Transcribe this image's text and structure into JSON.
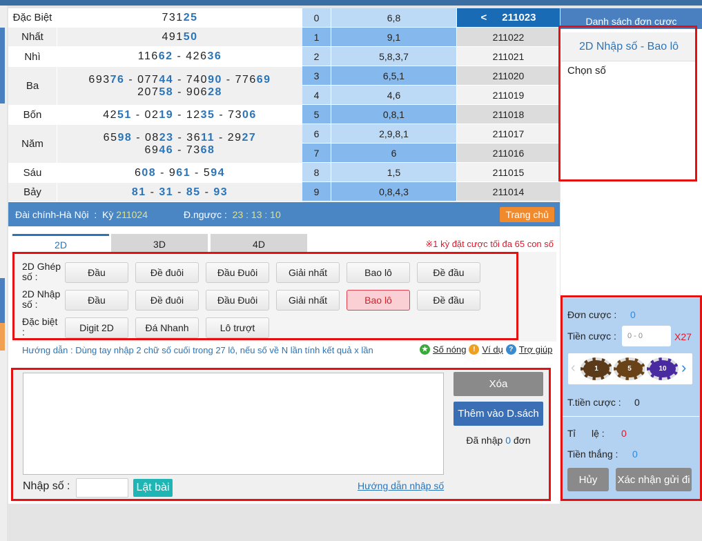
{
  "results": [
    {
      "label": "Đặc Biệt",
      "lines": [
        [
          [
            "731",
            "25"
          ]
        ]
      ]
    },
    {
      "label": "Nhất",
      "lines": [
        [
          [
            "491",
            "50"
          ]
        ]
      ]
    },
    {
      "label": "Nhì",
      "lines": [
        [
          [
            "116",
            "62"
          ],
          [
            "426",
            "36"
          ]
        ]
      ]
    },
    {
      "label": "Ba",
      "lines": [
        [
          [
            "693",
            "76"
          ],
          [
            "077",
            "44"
          ],
          [
            "740",
            "90"
          ],
          [
            "776",
            "69"
          ]
        ],
        [
          [
            "207",
            "58"
          ],
          [
            "906",
            "28"
          ]
        ]
      ]
    },
    {
      "label": "Bốn",
      "lines": [
        [
          [
            "42",
            "51"
          ],
          [
            "02",
            "19"
          ],
          [
            "12",
            "35"
          ],
          [
            "73",
            "06"
          ]
        ]
      ]
    },
    {
      "label": "Năm",
      "lines": [
        [
          [
            "65",
            "98"
          ],
          [
            "08",
            "23"
          ],
          [
            "36",
            "11"
          ],
          [
            "29",
            "27"
          ]
        ],
        [
          [
            "69",
            "46"
          ],
          [
            "73",
            "68"
          ]
        ]
      ]
    },
    {
      "label": "Sáu",
      "lines": [
        [
          [
            "6",
            "08"
          ],
          [
            "9",
            "61"
          ],
          [
            "5",
            "94"
          ]
        ]
      ]
    },
    {
      "label": "Bảy",
      "lines": [
        [
          [
            "",
            "81"
          ],
          [
            "",
            "31"
          ],
          [
            "",
            "85"
          ],
          [
            "",
            "93"
          ]
        ]
      ]
    }
  ],
  "stats": [
    {
      "digit": "0",
      "values": "6,8",
      "period": "211023"
    },
    {
      "digit": "1",
      "values": "9,1",
      "period": "211022"
    },
    {
      "digit": "2",
      "values": "5,8,3,7",
      "period": "211021"
    },
    {
      "digit": "3",
      "values": "6,5,1",
      "period": "211020"
    },
    {
      "digit": "4",
      "values": "4,6",
      "period": "211019"
    },
    {
      "digit": "5",
      "values": "0,8,1",
      "period": "211018"
    },
    {
      "digit": "6",
      "values": "2,9,8,1",
      "period": "211017"
    },
    {
      "digit": "7",
      "values": "6",
      "period": "211016"
    },
    {
      "digit": "8",
      "values": "1,5",
      "period": "211015"
    },
    {
      "digit": "9",
      "values": "0,8,4,3",
      "period": "211014"
    }
  ],
  "info": {
    "station": "Đài chính-Hà Nội",
    "ky_label": "Kỳ",
    "ky": "211024",
    "countdown_label": "Đ.ngược :",
    "countdown": "23 : 13 : 10",
    "home": "Trang chủ"
  },
  "tabs": [
    "2D",
    "3D",
    "4D"
  ],
  "limit_note": "※1 kỳ đặt cược tối đa 65 con số",
  "bet_groups": [
    {
      "label": "2D Ghép số :",
      "buttons": [
        "Đầu",
        "Đề đuôi",
        "Đầu Đuôi",
        "Giải nhất",
        "Bao lô",
        "Đề đầu"
      ]
    },
    {
      "label": "2D Nhập số :",
      "buttons": [
        "Đầu",
        "Đề đuôi",
        "Đầu Đuôi",
        "Giải nhất",
        "Bao lô",
        "Đề đầu"
      ],
      "selected": "Bao lô"
    },
    {
      "label": "Đặc biệt :",
      "buttons": [
        "Digit 2D",
        "Đá Nhanh",
        "Lô trượt"
      ]
    }
  ],
  "hint": "Hướng dẫn : Dùng tay nhập 2 chữ số cuối trong 27 lô, nếu số về N lần tính kết quả x lần",
  "links": [
    "Số nóng",
    "Ví dụ",
    "Trợ giúp"
  ],
  "input": {
    "textarea": "",
    "clear": "Xóa",
    "add": "Thêm vào D.sách",
    "entered_pre": "Đã nhập",
    "entered_count": "0",
    "entered_post": "đơn",
    "nhap_label": "Nhập số :",
    "nhap_value": "",
    "flip": "Lật bài",
    "guide": "Hướng dẫn nhập số"
  },
  "right": {
    "header": "Danh sách đơn cược",
    "title": "2D Nhập số - Bao lô",
    "chon": "Chọn số",
    "don_label": "Đơn cược :",
    "don": "0",
    "tien_label": "Tiền cược :",
    "tien_placeholder": "0 - 0",
    "mult": "X27",
    "chips": [
      "1",
      "5",
      "10"
    ],
    "total_label": "T.tiền cược :",
    "total": "0",
    "rate_label": "Tỉ      lệ :",
    "rate": "0",
    "win_label": "Tiền thắng :",
    "win": "0",
    "cancel": "Hủy",
    "confirm": "Xác nhận gửi đi"
  },
  "colors": {
    "accent": "#2a74b8",
    "selected": "#fbd0d4",
    "highlight": "#e51010"
  }
}
